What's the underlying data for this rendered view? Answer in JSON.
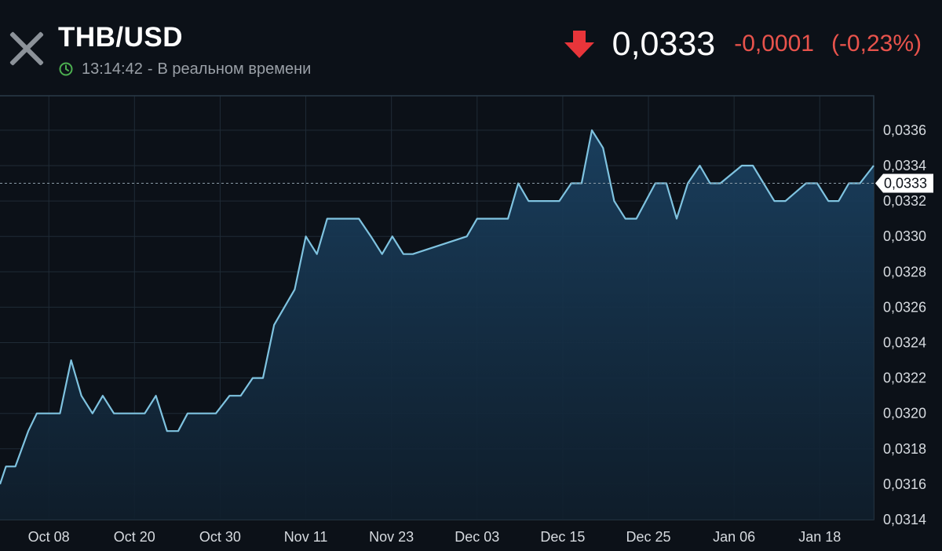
{
  "header": {
    "title": "THB/USD",
    "time": "13:14:42",
    "separator": "-",
    "realtime_label": "В реальном времени",
    "price": "0,0333",
    "change": "-0,0001",
    "change_pct": "(-0,23%)",
    "icons": {
      "close": "close-icon",
      "clock": "clock-icon",
      "direction": "down-arrow-icon"
    },
    "colors": {
      "negative": "#e8534c",
      "clock": "#4caf50",
      "line": "#7fc3e0"
    }
  },
  "chart_data": {
    "type": "area",
    "title": "",
    "xlabel": "",
    "ylabel": "",
    "ylim": [
      0.0314,
      0.0337
    ],
    "y_ticks": [
      "0,0336",
      "0,0334",
      "0,0332",
      "0,0330",
      "0,0328",
      "0,0326",
      "0,0324",
      "0,0322",
      "0,0320",
      "0,0318",
      "0,0316",
      "0,0314"
    ],
    "y_tick_values": [
      0.0336,
      0.0334,
      0.0332,
      0.033,
      0.0328,
      0.0326,
      0.0324,
      0.0322,
      0.032,
      0.0318,
      0.0316,
      0.0314
    ],
    "x_ticks": [
      "Oct 08",
      "Oct 20",
      "Oct 30",
      "Nov 11",
      "Nov 23",
      "Dec 03",
      "Dec 15",
      "Dec 25",
      "Jan 06",
      "Jan 18"
    ],
    "x_tick_positions": [
      5.7,
      15.7,
      25.7,
      35.7,
      45.7,
      55.7,
      65.7,
      75.7,
      85.7,
      95.7
    ],
    "x_range": [
      0,
      102
    ],
    "current_value": 0.0333,
    "current_label": "0,0333",
    "grid": true,
    "series": [
      {
        "x": [
          0,
          0.7,
          1.8,
          3.3,
          4.3,
          7.0,
          8.3,
          9.5,
          10.8,
          12.0,
          13.3,
          16.9,
          18.2,
          19.5,
          20.8,
          21.9,
          25.2,
          26.8,
          28.1,
          29.5,
          30.7,
          32.0,
          34.4,
          35.7,
          37.0,
          38.2,
          41.9,
          43.3,
          44.6,
          45.8,
          47.1,
          48.2,
          54.5,
          55.7,
          59.3,
          60.5,
          61.7,
          65.3,
          66.7,
          67.9,
          69.1,
          70.4,
          71.7,
          73.0,
          74.3,
          76.5,
          77.8,
          79.0,
          80.3,
          81.7,
          82.9,
          84.1,
          86.6,
          87.9,
          90.4,
          91.7,
          94.1,
          95.4,
          96.7,
          97.9,
          99.1,
          100.4,
          102.0
        ],
        "y": [
          0.0316,
          0.0317,
          0.0317,
          0.0319,
          0.032,
          0.032,
          0.0323,
          0.0321,
          0.032,
          0.0321,
          0.032,
          0.032,
          0.0321,
          0.0319,
          0.0319,
          0.032,
          0.032,
          0.0321,
          0.0321,
          0.0322,
          0.0322,
          0.0325,
          0.0327,
          0.033,
          0.0329,
          0.0331,
          0.0331,
          0.033,
          0.0329,
          0.033,
          0.0329,
          0.0329,
          0.033,
          0.0331,
          0.0331,
          0.0333,
          0.0332,
          0.0332,
          0.0333,
          0.0333,
          0.0336,
          0.0335,
          0.0332,
          0.0331,
          0.0331,
          0.0333,
          0.0333,
          0.0331,
          0.0333,
          0.0334,
          0.0333,
          0.0333,
          0.0334,
          0.0334,
          0.0332,
          0.0332,
          0.0333,
          0.0333,
          0.0332,
          0.0332,
          0.0333,
          0.0333,
          0.0334
        ]
      }
    ]
  }
}
